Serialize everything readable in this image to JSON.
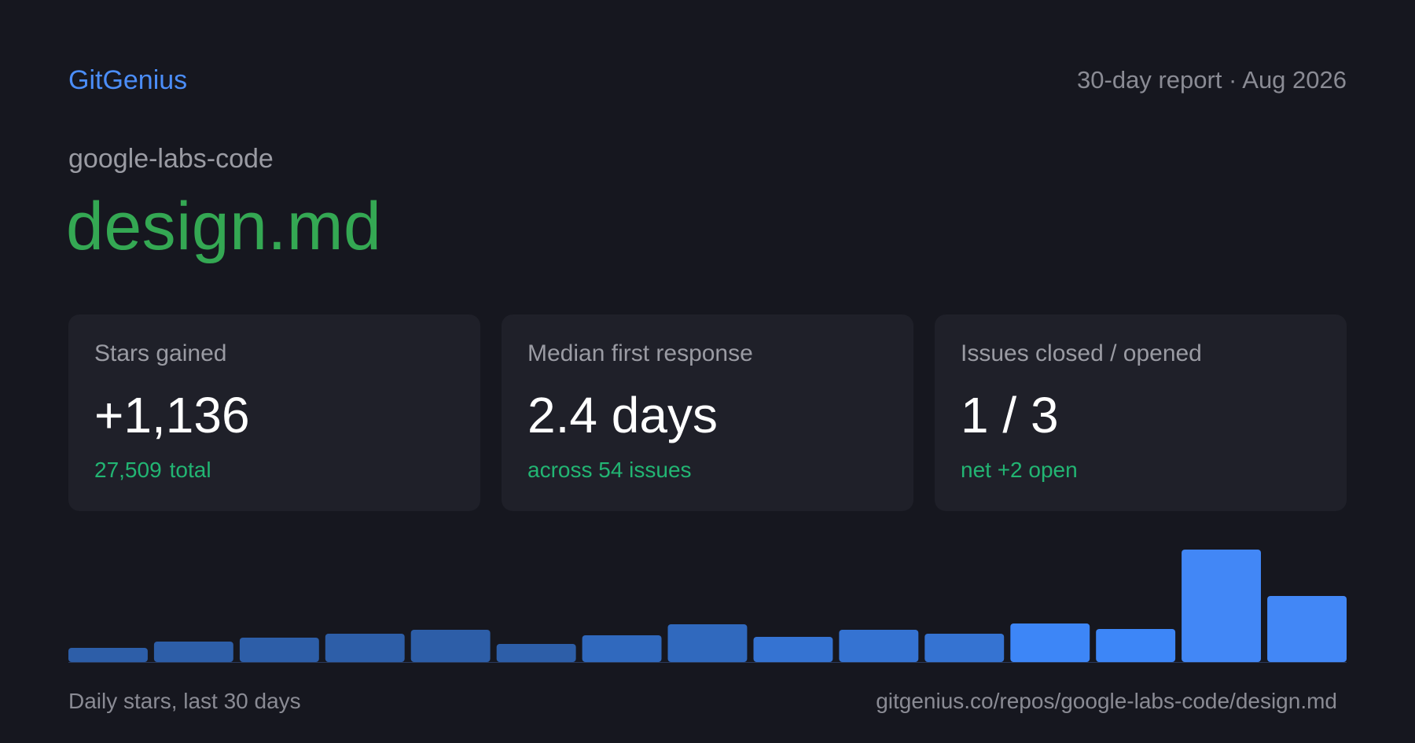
{
  "header": {
    "brand": "GitGenius",
    "report": "30-day report · Aug 2026"
  },
  "repo": {
    "owner": "google-labs-code",
    "name": "design.md"
  },
  "cards": [
    {
      "label": "Stars gained",
      "value": "+1,136",
      "sub_a": "27,509",
      "sub_b": "total"
    },
    {
      "label": "Median first response",
      "value": "2.4 days",
      "sub": "across 54 issues"
    },
    {
      "label": "Issues closed / opened",
      "value": "1 / 3",
      "sub": "net +2 open"
    }
  ],
  "chart_data": {
    "type": "bar",
    "values": [
      18,
      26,
      31,
      36,
      41,
      23,
      34,
      48,
      32,
      41,
      36,
      49,
      42,
      143,
      84
    ],
    "colors": [
      "#2d5ea8",
      "#2d5ea8",
      "#2d5ea8",
      "#2d5ea8",
      "#2d5ea8",
      "#2d5ea8",
      "#3069be",
      "#3069be",
      "#3573d2",
      "#3573d2",
      "#3573d2",
      "#3d86f7",
      "#3d86f7",
      "#4287f6",
      "#4287f6"
    ],
    "ylim": [
      0,
      143
    ]
  },
  "footer": {
    "caption": "Daily stars, last 30 days",
    "url": "gitgenius.co/repos/google-labs-code/design.md"
  }
}
